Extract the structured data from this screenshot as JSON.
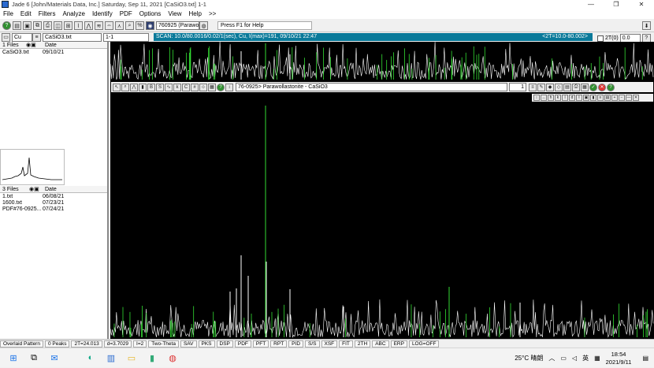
{
  "window": {
    "title": "Jade 6 [John/Materials Data, Inc.] Saturday, Sep 11, 2021 [CaSiO3.txt] 1-1",
    "min": "—",
    "max": "❐",
    "close": "✕"
  },
  "menu": [
    "File",
    "Edit",
    "Filters",
    "Analyze",
    "Identify",
    "PDF",
    "Options",
    "View",
    "Help",
    ">>"
  ],
  "toolbar": {
    "pdf_select": "760925 (Parawo",
    "hint": "Press F1 for Help"
  },
  "row2": {
    "element_select": "Cu",
    "file_select": "CaSiO3.txt",
    "field": "1-1",
    "scan_info": "SCAN: 10.0/80.0016/0.02/1(sec), Cu, I(max)=191, 09/10/21 22:47",
    "range": "<2T=10.0-80.002>",
    "twotheta_label": "2T(0)",
    "twotheta_value": "0.0"
  },
  "files_panel": {
    "count": "1 Files",
    "date_header": "Date",
    "rows": [
      {
        "name": "CaSiO3.txt",
        "date": "09/10/21"
      }
    ]
  },
  "files_panel2": {
    "count": "3 Files",
    "date_header": "Date",
    "rows": [
      {
        "name": "1.txt",
        "date": "06/08/21"
      },
      {
        "name": "1600.txt",
        "date": "07/23/21"
      },
      {
        "name": "PDF#76-0925...",
        "date": "07/24/21"
      }
    ]
  },
  "chart_toolbar": {
    "phase": "76-0925> Parawollastonite - CaSiO3",
    "num": "1"
  },
  "status": [
    "Overlaid Pattern",
    "0 Peaks",
    "2T=24.013",
    "d=3.7029",
    "I=2",
    "Two-Theta",
    "SAV",
    "PKS",
    "DSP",
    "PDF",
    "PFT",
    "RPT",
    "PID",
    "S/S",
    "XSF",
    "FIT",
    "2TH",
    "ABC",
    "ERP",
    "LOG=OFF"
  ],
  "taskbar": {
    "weather": "25°C 晴朗",
    "lang": "英",
    "time": "18:54",
    "date": "2021/9/11"
  },
  "colors": {
    "pattern": "#ffffff",
    "reference": "#33dd33",
    "scan_strip": "#0a7a9a"
  }
}
